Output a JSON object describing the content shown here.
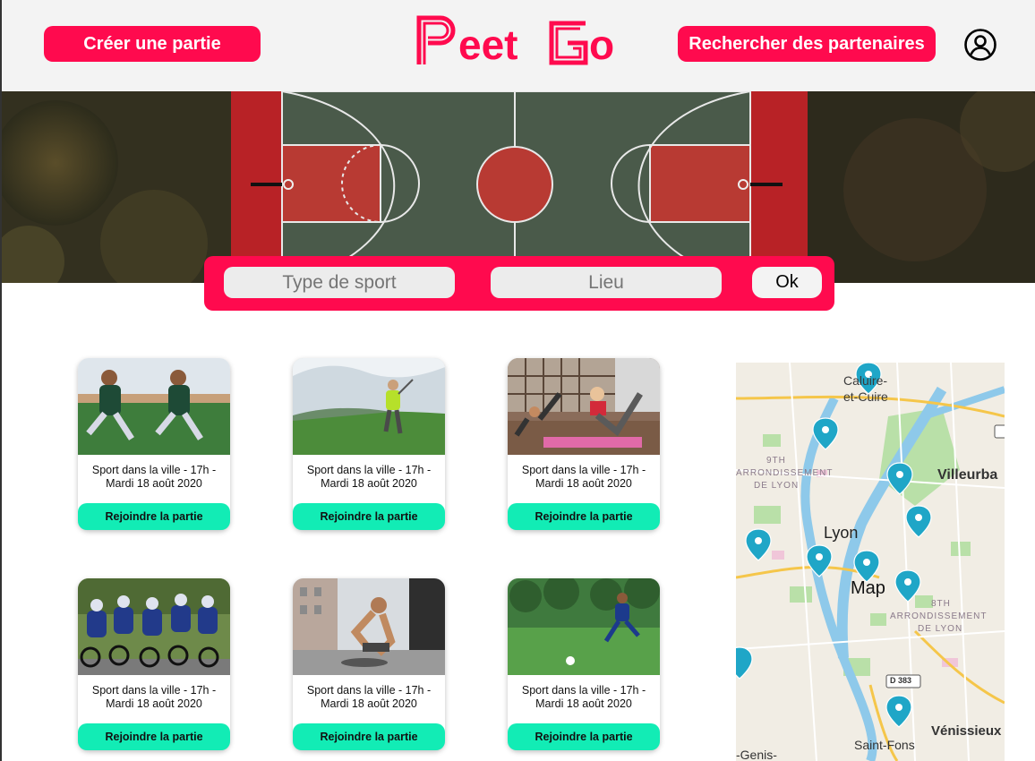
{
  "header": {
    "create_label": "Créer une partie",
    "logo_text": "PeetGo",
    "search_partners_label": "Rechercher des partenaires"
  },
  "search": {
    "sport_placeholder": "Type de sport",
    "place_placeholder": "Lieu",
    "ok_label": "Ok"
  },
  "cards": [
    {
      "text": "Sport dans la ville - 17h - Mardi 18 août 2020",
      "button": "Rejoindre la partie",
      "image": "football-player-kick"
    },
    {
      "text": "Sport dans la ville - 17h - Mardi 18 août 2020",
      "button": "Rejoindre la partie",
      "image": "golfer-swing"
    },
    {
      "text": "Sport dans la ville - 17h - Mardi 18 août 2020",
      "button": "Rejoindre la partie",
      "image": "fitness-workout"
    },
    {
      "text": "Sport dans la ville - 17h - Mardi 18 août 2020",
      "button": "Rejoindre la partie",
      "image": "cycling-race"
    },
    {
      "text": "Sport dans la ville - 17h - Mardi 18 août 2020",
      "button": "Rejoindre la partie",
      "image": "runner-tying-shoes"
    },
    {
      "text": "Sport dans la ville - 17h - Mardi 18 août 2020",
      "button": "Rejoindre la partie",
      "image": "football-player-field"
    }
  ],
  "map": {
    "title": "Map",
    "labels": {
      "caluire": "Caluire-",
      "caluire2": "et-Cuire",
      "ninth": "9TH",
      "arr": "ARRONDISSEMENT",
      "delyon": "DE LYON",
      "villeurbanne": "Villeurba",
      "lyon": "Lyon",
      "eighth": "8TH",
      "arr2": "ARRONDISSEMENT",
      "delyon2": "DE LYON",
      "road": "D 383",
      "venissieux": "Vénissieux",
      "saintfons": "Saint-Fons",
      "genis": "-Genis-"
    }
  },
  "colors": {
    "brand": "#ff0a4e",
    "join": "#12ecb5",
    "header_bg": "#f3f3f3",
    "pin": "#1fa6c7"
  },
  "icons": {
    "account": "user-circle-icon",
    "pin": "map-pin-icon"
  }
}
